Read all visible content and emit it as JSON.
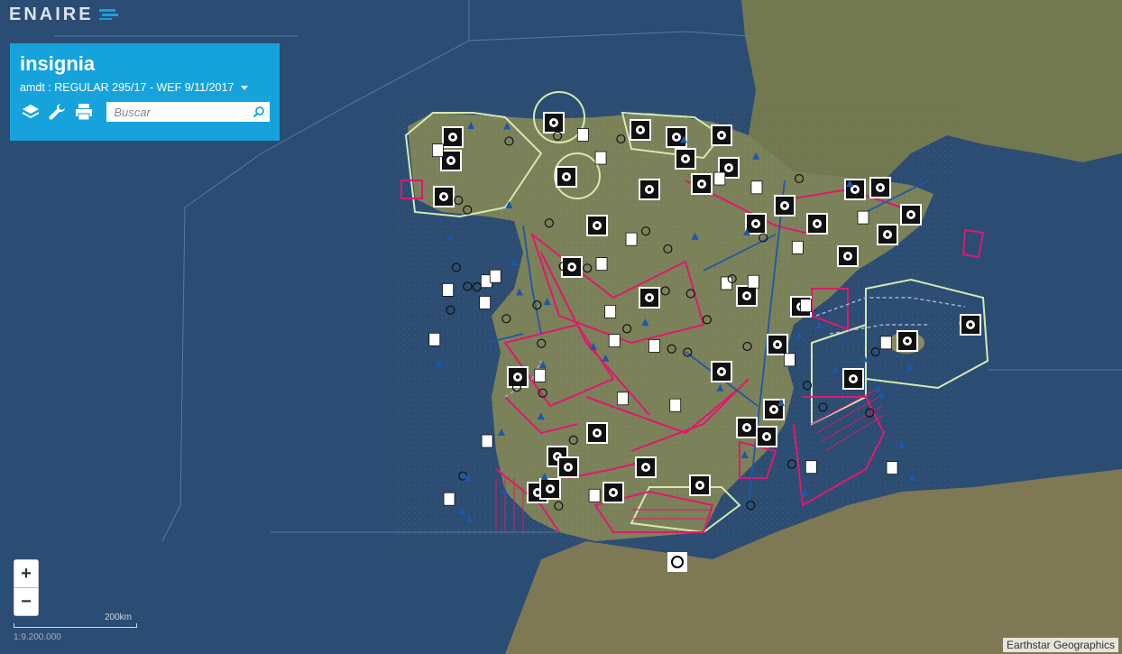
{
  "brand": {
    "logo_text": "ENAIRE"
  },
  "panel": {
    "title": "insignia",
    "amdt": "amdt : REGULAR 295/17 - WEF 9/11/2017",
    "search_placeholder": "Buscar"
  },
  "tools": [
    "layers-icon",
    "wrench-icon",
    "print-icon",
    "search-icon"
  ],
  "zoom": {
    "in_label": "+",
    "out_label": "−"
  },
  "scale": {
    "distance_label": "200km",
    "ratio_label": "1:9.200.000"
  },
  "attribution": "Earthstar Geographics",
  "colors": {
    "panel": "#16a3dc",
    "sea": "#2a4a6f",
    "land": "#7d8560",
    "airspace_magenta": "#e0186f",
    "airspace_blue": "#1f57a8",
    "airspace_green": "#c8e6a0"
  }
}
